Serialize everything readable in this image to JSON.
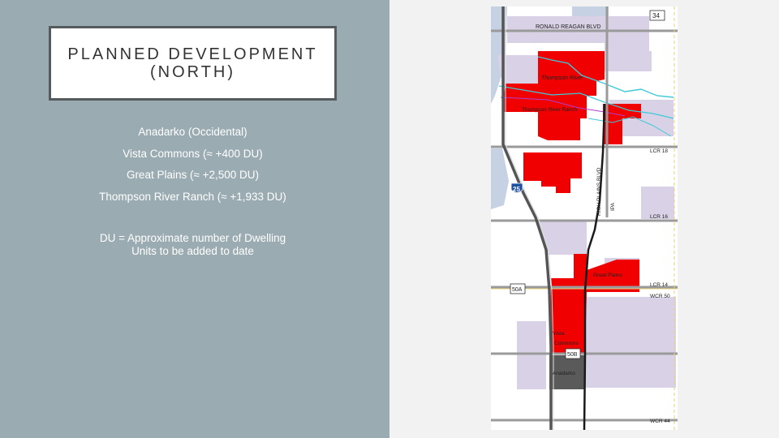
{
  "slide": {
    "title_lines": [
      "PLANNED DEVELOPMENT",
      "(NORTH)"
    ],
    "bullets": [
      "Anadarko (Occidental)",
      "Vista Commons (≈ +400 DU)",
      "Great Plains (≈ +2,500 DU)",
      "Thompson River Ranch (≈ +1,933 DU)"
    ],
    "note_lines": [
      "DU = Approximate number of Dwelling",
      "Units to be added to date"
    ]
  },
  "map": {
    "road_labels": {
      "ronald_reagan": "RONALD REAGAN BLVD",
      "route_34": "34",
      "high_plains": "HIGH PLAINS BLVD",
      "ipa": "IPA",
      "lcr_18": "LCR 18",
      "lcr_16": "LCR 16",
      "lcr_14": "LCR 14",
      "wcr_50": "WCR 50",
      "route_50a": "50A",
      "route_50b": "50B",
      "interstate_25": "25",
      "wcr_44": "WCR 44"
    },
    "area_labels": {
      "thompson_river": "Thompson River",
      "thompson_river_ranch": "Thompson River Ranch",
      "great_plains": "Great Plains",
      "vista_commons_1": "Vista",
      "vista_commons_2": "Commons",
      "anadarko": "Anadarko"
    },
    "colors": {
      "planned": "#f00000",
      "existing": "#d9d2e6",
      "anadarko": "#5a5a5a",
      "river": "#3fc9d8",
      "highway": "#1a1a1a",
      "county_road": "#9a9a9a"
    }
  }
}
